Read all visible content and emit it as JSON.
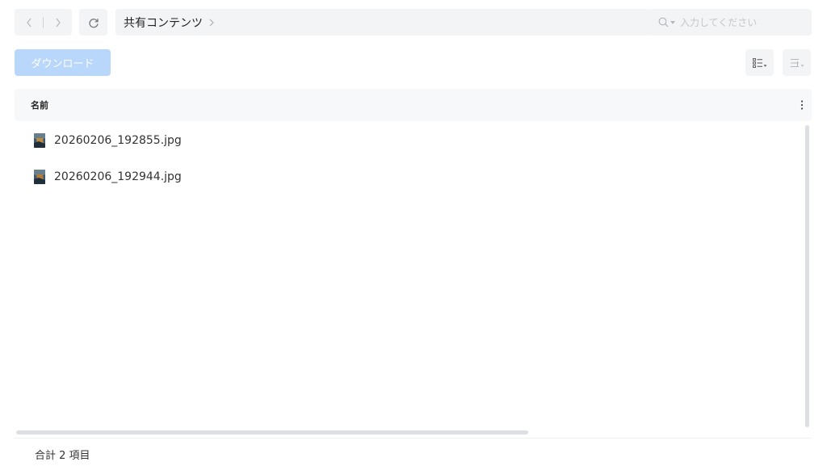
{
  "toolbar": {
    "back_icon": "chevron-left-icon",
    "forward_icon": "chevron-right-icon",
    "refresh_icon": "refresh-icon",
    "breadcrumb": {
      "folder": "共有コンテンツ",
      "separator_icon": "chevron-right-icon"
    },
    "search": {
      "icon": "search-icon",
      "placeholder": "入力してください",
      "value": ""
    }
  },
  "actions": {
    "download_label": "ダウンロード",
    "download_enabled": false,
    "list_view_icon": "list-view-icon",
    "sort_icon": "sort-icon"
  },
  "table": {
    "columns": [
      {
        "label": "名前"
      }
    ],
    "menu_icon": "vertical-dots-icon",
    "rows": [
      {
        "name": "20260206_192855.jpg",
        "icon": "image-thumbnail-icon"
      },
      {
        "name": "20260206_192944.jpg",
        "icon": "image-thumbnail-icon"
      }
    ]
  },
  "footer": {
    "total_label": "合計 2 項目"
  },
  "colors": {
    "accent_disabled": "#b9d6fb",
    "control_bg": "#f3f4f5",
    "header_bg": "#f7f8f9"
  }
}
